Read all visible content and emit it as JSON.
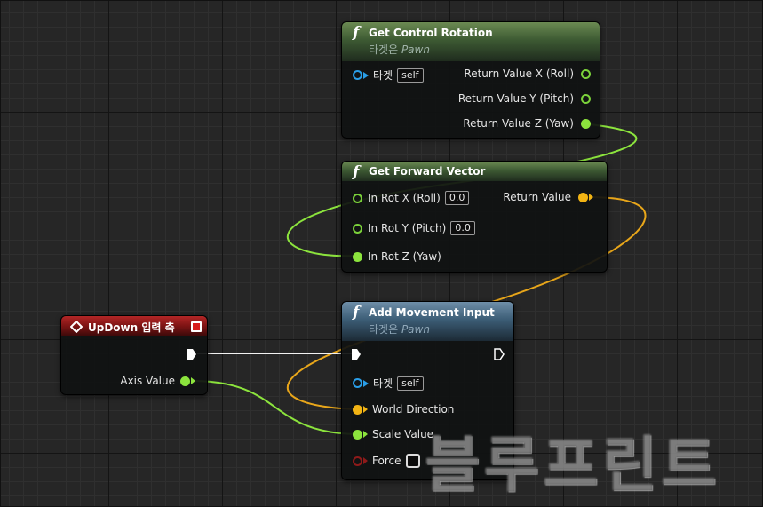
{
  "nodes": {
    "get_control_rotation": {
      "title": "Get Control Rotation",
      "subtitle_prefix": "타겟은 ",
      "subtitle_class": "Pawn",
      "target_label": "타겟",
      "target_value": "self",
      "outputs": [
        "Return Value X (Roll)",
        "Return Value Y (Pitch)",
        "Return Value Z (Yaw)"
      ]
    },
    "get_forward_vector": {
      "title": "Get Forward Vector",
      "inputs": [
        {
          "label": "In Rot X (Roll)",
          "value": "0.0"
        },
        {
          "label": "In Rot Y (Pitch)",
          "value": "0.0"
        },
        {
          "label": "In Rot Z (Yaw)",
          "value": ""
        }
      ],
      "output": "Return Value"
    },
    "updown_axis": {
      "title": "UpDown 입력 축",
      "output": "Axis Value"
    },
    "add_movement_input": {
      "title": "Add Movement Input",
      "subtitle_prefix": "타겟은 ",
      "subtitle_class": "Pawn",
      "target_label": "타겟",
      "target_value": "self",
      "world_direction": "World Direction",
      "scale_value": "Scale Value",
      "force": "Force"
    }
  },
  "watermark": "블루프린트",
  "colors": {
    "float_pin": "#8ce43d",
    "vector_pin": "#f2b414",
    "object_pin": "#2a9ee8",
    "bool_pin": "#8e1a1a",
    "exec_pin": "#ffffff",
    "pure_header": "#4f6b40",
    "impure_header": "#4a6b86",
    "event_header": "#9a1c1c"
  },
  "icons": [
    "function-icon",
    "diamond-event-icon",
    "exec-pin-icon",
    "data-pin-icon"
  ]
}
